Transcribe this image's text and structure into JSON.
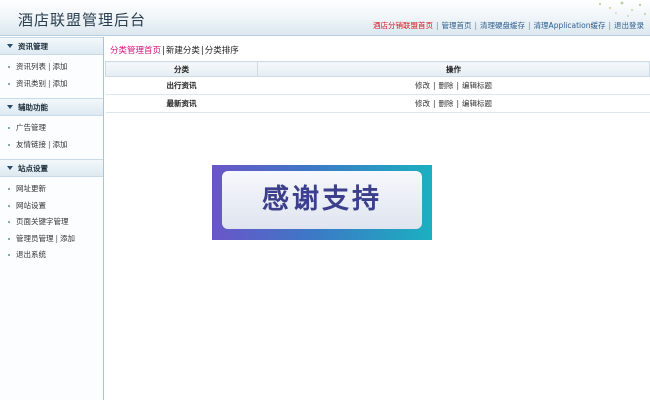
{
  "header": {
    "title": "酒店联盟管理后台",
    "links": [
      {
        "label": "酒店分销联盟首页",
        "active": true
      },
      {
        "label": "管理首页"
      },
      {
        "label": "清理硬盘缓存"
      },
      {
        "label": "清理Application缓存"
      },
      {
        "label": "退出登录"
      }
    ]
  },
  "sidebar": {
    "groups": [
      {
        "title": "资讯管理",
        "items": [
          {
            "label": "资讯列表",
            "extra": "添加"
          },
          {
            "label": "资讯类别",
            "extra": "添加"
          }
        ]
      },
      {
        "title": "辅助功能",
        "items": [
          {
            "label": "广告管理"
          },
          {
            "label": "友情链接",
            "extra": "添加"
          }
        ]
      },
      {
        "title": "站点设置",
        "items": [
          {
            "label": "网址更新"
          },
          {
            "label": "网站设置"
          },
          {
            "label": "页面关键字管理"
          },
          {
            "label": "管理员管理",
            "extra": "添加"
          },
          {
            "label": "退出系统"
          }
        ]
      }
    ]
  },
  "main": {
    "subnav": {
      "current": "分类管理首页",
      "items": [
        "新建分类",
        "分类排序"
      ]
    },
    "table": {
      "headers": [
        "分类",
        "操作"
      ],
      "rows": [
        {
          "name": "出行资讯",
          "ops": [
            "修改",
            "删除",
            "编辑标题"
          ]
        },
        {
          "name": "最新资讯",
          "ops": [
            "修改",
            "删除",
            "编辑标题"
          ]
        }
      ]
    },
    "thanks_banner": "感谢支持"
  },
  "colors": {
    "accent_red": "#d8141e",
    "accent_pink": "#d8147e",
    "link_blue": "#2f5f8f"
  }
}
